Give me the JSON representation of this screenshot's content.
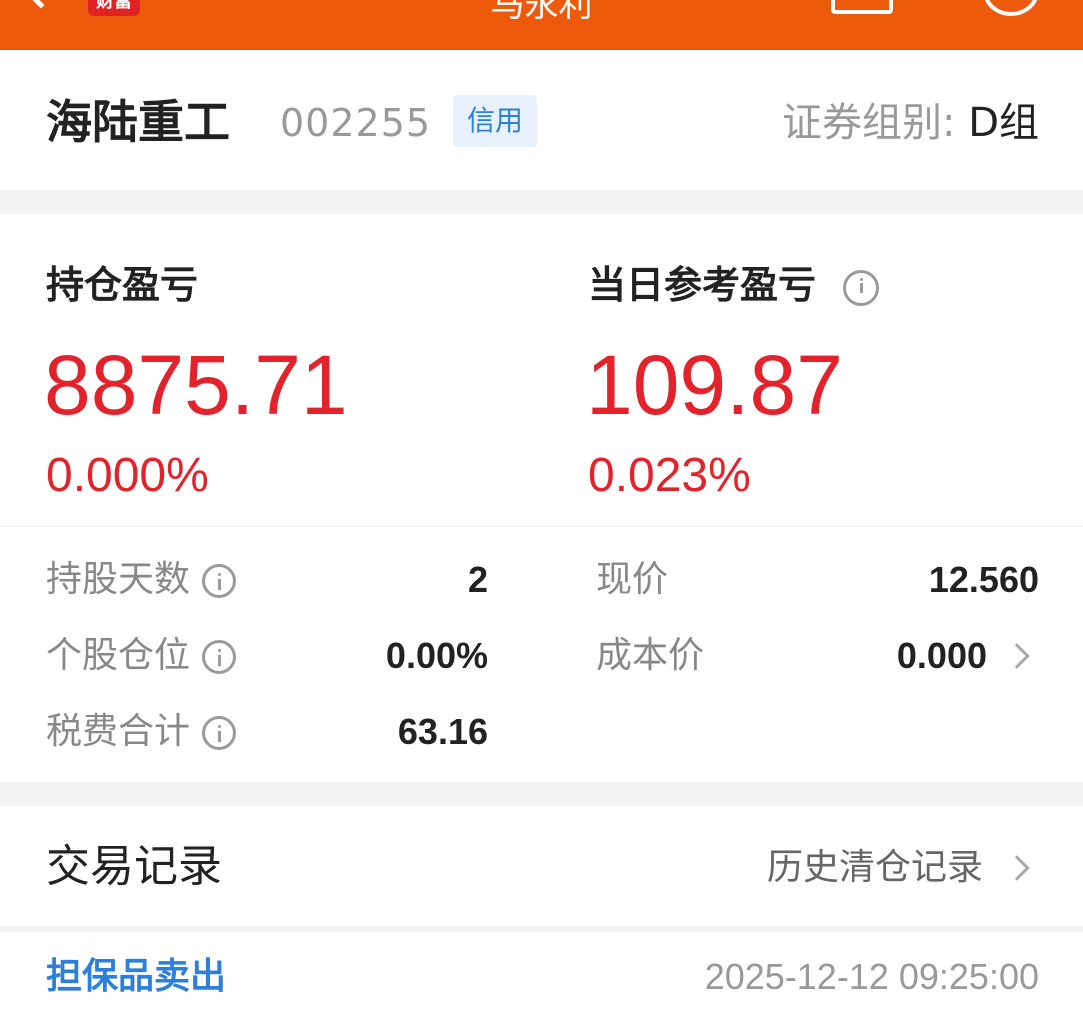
{
  "topbar": {
    "badge": "财富",
    "title": "马永利"
  },
  "stock": {
    "name": "海陆重工",
    "code": "002255",
    "tag": "信用",
    "group_label": "证券组别:",
    "group_value": "D组"
  },
  "pnl": {
    "holding_title": "持仓盈亏",
    "holding_value": "8875.71",
    "holding_pct": "0.000%",
    "daily_title": "当日参考盈亏",
    "daily_value": "109.87",
    "daily_pct": "0.023%"
  },
  "stats": {
    "days_label": "持股天数",
    "days_value": "2",
    "position_label": "个股仓位",
    "position_value": "0.00%",
    "fees_label": "税费合计",
    "fees_value": "63.16",
    "price_label": "现价",
    "price_value": "12.560",
    "cost_label": "成本价",
    "cost_value": "0.000"
  },
  "records": {
    "title": "交易记录",
    "history_link": "历史清仓记录",
    "first_type": "担保品卖出",
    "first_time": "2025-12-12 09:25:00"
  },
  "colors": {
    "topbar": "#ee5a0c",
    "profit_red": "#e3232c",
    "link_blue": "#2e7fd8"
  }
}
